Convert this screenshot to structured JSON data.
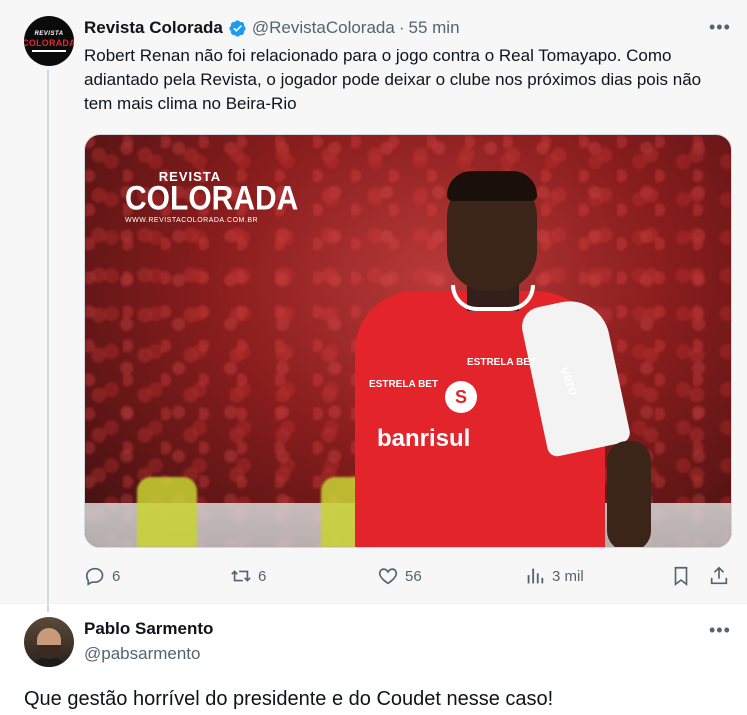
{
  "tweet1": {
    "author_name": "Revista Colorada",
    "author_handle": "@RevistaColorada",
    "separator": "·",
    "time": "55 min",
    "more": "•••",
    "text": "Robert Renan não foi relacionado para o jogo contra o Real Tomayapo. Como adiantado pela Revista, o jogador pode deixar o clube nos próximos dias pois não tem mais clima no Beira-Rio",
    "avatar_text": {
      "line1": "REVISTA",
      "line2": "COLORADA"
    },
    "media": {
      "watermark_top": "REVISTA",
      "watermark_main": "COLORADA",
      "watermark_url": "WWW.REVISTACOLORADA.COM.BR",
      "jersey_sponsor": "banrisul",
      "jersey_badge": "S",
      "jersey_chest_left": "ESTRELA BET",
      "jersey_chest_right": "ESTRELA BET",
      "jersey_sleeve": "vero"
    },
    "actions": {
      "replies": "6",
      "retweets": "6",
      "likes": "56",
      "views": "3 mil"
    }
  },
  "tweet2": {
    "author_name": "Pablo Sarmento",
    "author_handle": "@pabsarmento",
    "more": "•••",
    "text": "Que gestão horrível do presidente e do Coudet nesse caso!"
  },
  "colors": {
    "text_primary": "#0f1419",
    "text_secondary": "#536471",
    "verified_blue": "#1d9bf0",
    "thread_line": "#cfd9de"
  }
}
